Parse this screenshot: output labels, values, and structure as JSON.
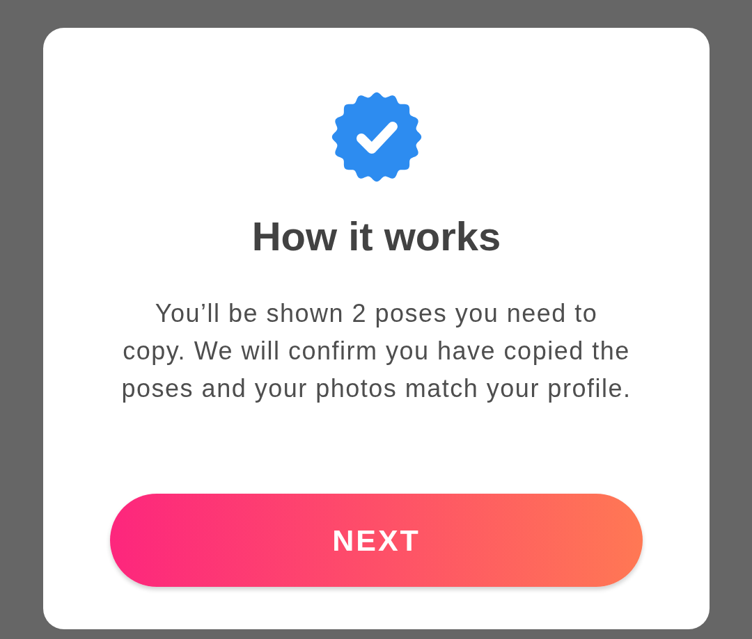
{
  "dialog": {
    "title": "How it works",
    "body": "You’ll be shown 2 poses you need to copy. We will confirm you have copied the poses and your photos match your profile.",
    "button": "NEXT"
  }
}
